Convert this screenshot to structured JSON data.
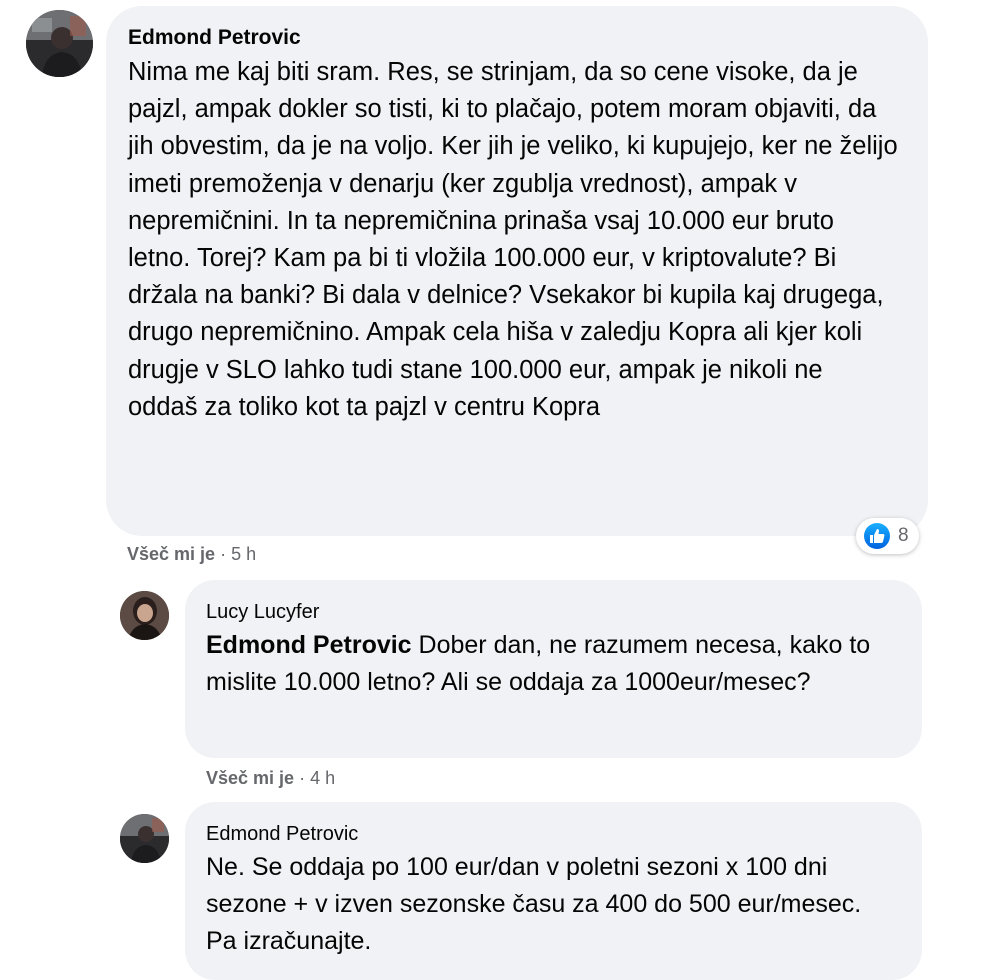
{
  "comments": [
    {
      "author": "Edmond Petrovic",
      "text": "Nima me kaj biti sram. Res, se strinjam, da so cene visoke, da je pajzl, ampak dokler so tisti, ki to plačajo, potem moram objaviti, da jih obvestim, da je na voljo. Ker jih je veliko, ki kupujejo, ker ne želijo imeti premoženja v denarju (ker zgublja vrednost), ampak v nepremičnini. In ta nepremičnina prinaša vsaj 10.000 eur bruto letno. Torej? Kam pa bi ti vložila 100.000 eur, v kriptovalute? Bi držala na banki? Bi dala v delnice? Vsekakor bi kupila kaj drugega, drugo nepremičnino. Ampak cela hiša v zaledju Kopra ali kjer koli drugje v SLO lahko tudi stane 100.000 eur, ampak je nikoli ne oddaš za toliko kot ta pajzl v centru Kopra",
      "like_label": "Všeč mi je",
      "separator": "·",
      "time": "5 h",
      "reaction_count": "8",
      "reaction_icon": "like-icon",
      "avatar_icon": "profile-photo-icon"
    },
    {
      "author": "Lucy Lucyfer",
      "mention": "Edmond Petrovic",
      "text": " Dober dan, ne razumem necesa, kako to mislite 10.000 letno? Ali se oddaja za 1000eur/mesec?",
      "like_label": "Všeč mi je",
      "separator": "·",
      "time": "4 h",
      "avatar_icon": "profile-photo-icon"
    },
    {
      "author": "Edmond Petrovic",
      "text": "Ne. Se oddaja po 100 eur/dan v poletni sezoni x 100 dni sezone + v izven sezonske času za 400 do 500 eur/mesec. Pa izračunajte.",
      "avatar_icon": "profile-photo-icon"
    }
  ],
  "colors": {
    "bubble": "#f0f2f5",
    "meta": "#65676b",
    "like_blue": "#1877f2"
  }
}
